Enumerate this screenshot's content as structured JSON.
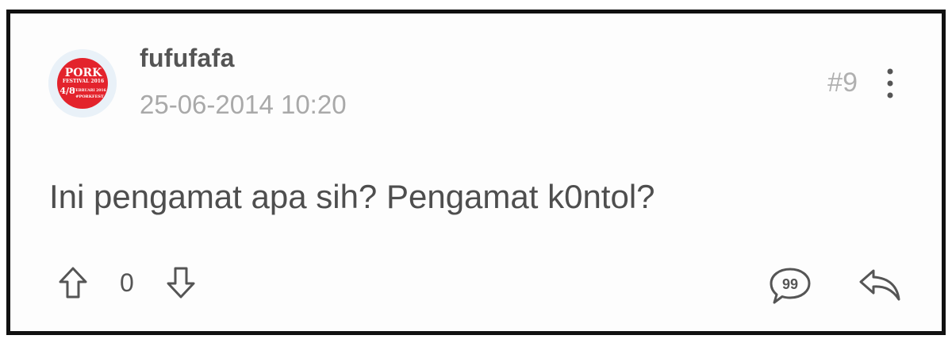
{
  "post": {
    "author": {
      "username": "fufufafa",
      "avatar": {
        "line1": "PORK",
        "line2": "FESTIVAL 2016",
        "line3": "4/8",
        "line4": "FEBRUARI 2016",
        "line5": "#PORKFEST",
        "colors": {
          "badge": "#e3232c",
          "background": "#e9f1f8"
        }
      }
    },
    "timestamp": "25-06-2014 10:20",
    "number": "#9",
    "body": "Ini pengamat apa sih? Pengamat k0ntol?",
    "votes": {
      "count": "0",
      "up_icon": "arrow-up-outline-icon",
      "down_icon": "arrow-down-outline-icon"
    },
    "actions": {
      "more_icon": "vertical-ellipsis-icon",
      "quote_icon": "quote-bubble-icon",
      "reply_icon": "reply-arrow-icon"
    }
  }
}
